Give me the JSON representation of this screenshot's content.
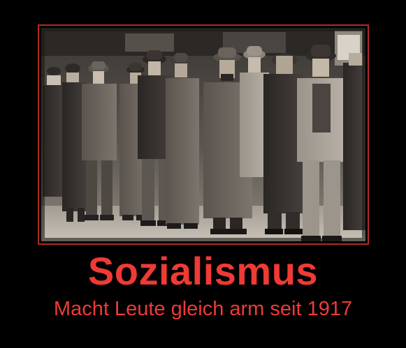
{
  "poster": {
    "title": "Sozialismus",
    "subtitle": "Macht Leute gleich arm seit 1917",
    "accent_color": "#ef3a36",
    "frame_color": "#b22a22",
    "background_color": "#000000"
  },
  "photo": {
    "style": "sepia-monochrome",
    "depicts": "bread-line-of-men-in-coats-and-hats"
  }
}
